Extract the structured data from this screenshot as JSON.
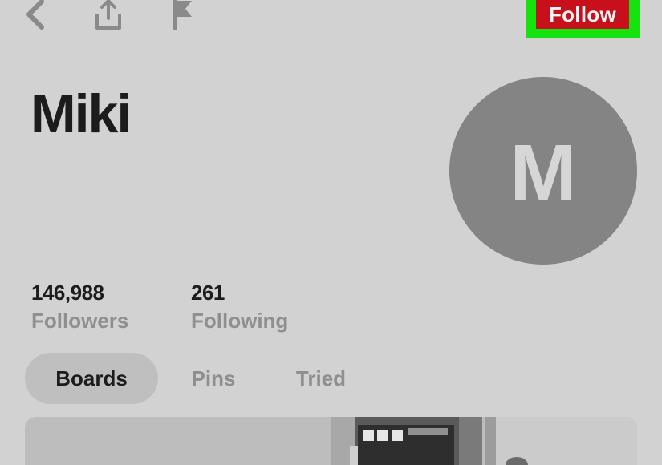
{
  "header": {
    "back_icon": "chevron-left-icon",
    "share_icon": "share-icon",
    "flag_icon": "flag-icon",
    "follow_label": "Follow"
  },
  "profile": {
    "name": "Miki",
    "avatar_letter": "M"
  },
  "stats": {
    "followers_count": "146,988",
    "followers_label": "Followers",
    "following_count": "261",
    "following_label": "Following"
  },
  "tabs": [
    {
      "label": "Boards",
      "selected": true
    },
    {
      "label": "Pins",
      "selected": false
    },
    {
      "label": "Tried",
      "selected": false
    }
  ],
  "colors": {
    "background": "#d2d2d2",
    "follow_button": "#c8101c",
    "highlight": "#15e20f",
    "avatar": "#848484"
  }
}
